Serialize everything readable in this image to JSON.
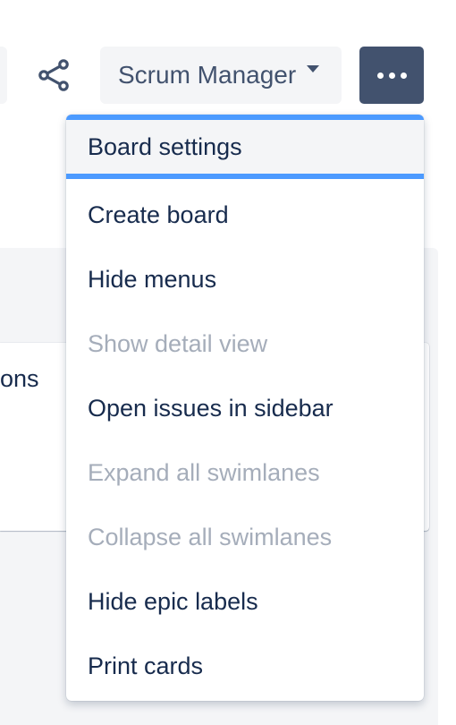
{
  "header": {
    "board_selector": {
      "label": "Scrum Manager"
    },
    "share_icon": "share-icon",
    "more_icon": "more-horizontal-icon"
  },
  "board": {
    "card_text_fragment": "ons"
  },
  "menu": {
    "items": [
      {
        "label": "Board settings",
        "state": "focused"
      },
      {
        "label": "Create board",
        "state": "enabled"
      },
      {
        "label": "Hide menus",
        "state": "enabled"
      },
      {
        "label": "Show detail view",
        "state": "disabled"
      },
      {
        "label": "Open issues in sidebar",
        "state": "enabled"
      },
      {
        "label": "Expand all swimlanes",
        "state": "disabled"
      },
      {
        "label": "Collapse all swimlanes",
        "state": "disabled"
      },
      {
        "label": "Hide epic labels",
        "state": "enabled"
      },
      {
        "label": "Print cards",
        "state": "enabled"
      }
    ]
  },
  "colors": {
    "text_primary": "#172b4d",
    "text_disabled": "#a5adba",
    "button_dark": "#42526e",
    "focus_ring": "#4c9aff",
    "surface": "#f4f5f7"
  }
}
